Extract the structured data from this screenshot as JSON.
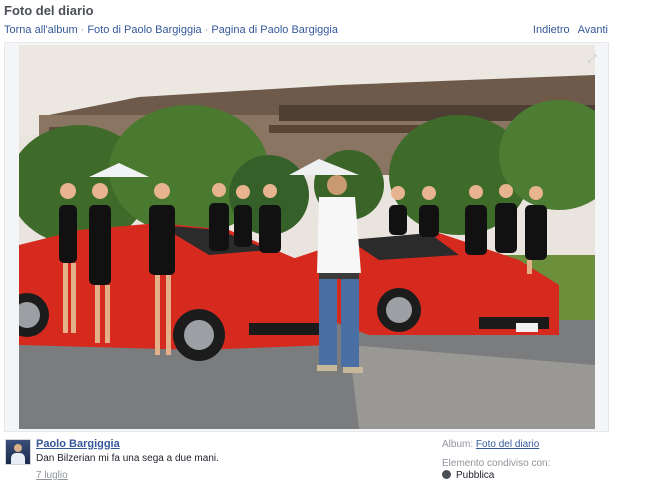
{
  "header": {
    "title": "Foto del diario",
    "breadcrumbs": [
      "Torna all'album",
      "Foto di Paolo Bargiggia",
      "Pagina di Paolo Bargiggia"
    ],
    "separator": "·",
    "prev_label": "Indietro",
    "next_label": "Avanti"
  },
  "photo": {
    "expand_icon": "expand-icon",
    "colors": {
      "sky": "#e9e4de",
      "car": "#d62a1e",
      "foliage": "#3f6b2a",
      "road": "#7a7c7e"
    }
  },
  "post": {
    "author": "Paolo Bargiggia",
    "caption": "Dan Bilzerian mi fa una sega a due mani.",
    "date": "7 luglio"
  },
  "meta": {
    "album_label": "Album:",
    "album_name": "Foto del diario",
    "shared_label": "Elemento condiviso con:",
    "privacy_icon": "globe-icon",
    "privacy": "Pubblica"
  }
}
